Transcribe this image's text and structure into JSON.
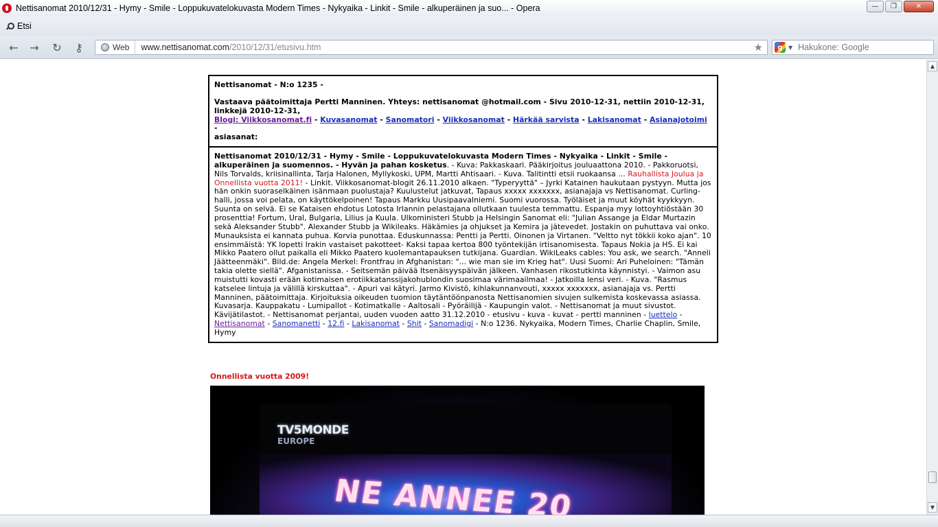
{
  "window": {
    "title": "Nettisanomat 2010/12/31 - Hymy - Smile - Loppukuvatelokuvasta Modern Times - Nykyaika - Linkit - Smile - alkuperäinen ja suo... - Opera",
    "buttons": {
      "minimize": "—",
      "maximize": "❐",
      "close": "✕"
    }
  },
  "tabbar": {
    "search_label": "Etsi"
  },
  "addressbar": {
    "back_icon": "back-arrow-icon",
    "web_label": "Web",
    "url_host": "www.nettisanomat.com",
    "url_path": "/2010/12/31/etusivu.htm",
    "search_placeholder": "Hakukone: Google",
    "search_engine_icon": "g"
  },
  "page": {
    "header": {
      "number": "Nettisanomat - N:o 1235 -",
      "editor": "Vastaava päätoimittaja Pertti Manninen. Yhteys: nettisanomat @hotmail.com - Sivu 2010-12-31, nettiin 2010-12-31, linkkejä 2010-12-31,",
      "links": [
        "Blogi: Viikkosanomat.fi",
        "Kuvasanomat",
        "Sanomatori",
        "Viikkosanomat",
        "Härkää sarvista",
        "Lakisanomat",
        "Asianajotoimi"
      ],
      "sep": " - ",
      "tail": " -",
      "keywords_label": "asiasanat:"
    },
    "article": {
      "lead_bold": "Nettisanomat 2010/12/31 - Hymy - Smile - Loppukuvatelokuvasta Modern Times - Nykyaika - Linkit - Smile - alkuperäinen ja suomennos. - Hyvän ja pahan kosketus",
      "text_1": ". - Kuva: Pakkaskaari. Pääkirjoitus jouluaattona 2010. - Pakkoruotsi, Nils Torvalds, kriisinallinta, Tarja Halonen, Myllykoski, UPM, Martti Ahtisaari. - Kuva. Talitintti etsii ruokaansa ... ",
      "text_red": "Rauhallista Joulua ja Onnellista vuotta 2011!",
      "text_2": " - Linkit. Viikkosanomat-blogit 26.11.2010 alkaen. \"Typeryyttä\" – Jyrki Katainen haukutaan pystyyn. Mutta jos hän onkin suoraselkäinen isänmaan puolustaja? Kuulustelut jatkuvat, Tapaus xxxxx xxxxxxx, asianajaja vs Nettisanomat. Curling-halli, jossa voi pelata, on käyttökelpoinen! Tapaus Markku Uusipaavalniemi. Suomi vuorossa. Työläiset ja muut köyhät kyykkyyn. Suunta on selvä. Ei se Kataisen ehdotus Lotosta Irlannin pelastajana ollutkaan tuulesta temmattu. Espanja myy lottoyhtiöstään 30 prosenttia! Fortum, Ural, Bulgaria, Lilius ja Kuula. Ulkoministeri Stubb ja Helsingin Sanomat eli: \"Julian Assange ja Eldar Murtazin sekä Aleksander Stubb\". Alexander Stubb ja Wikileaks. Häkämies ja ohjukset ja Kemira ja jätevedet. Jostakin on puhuttava vai onko. Munauksista ei kannata puhua. Korvia punottaa. Eduskunnassa: Pentti ja Pertti. Oinonen ja Virtanen. \"Veltto nyt tökkii koko ajan\". 10 ensimmäistä: YK lopetti Irakin vastaiset pakotteet- Kaksi tapaa kertoa 800 työntekijän irtisanomisesta. Tapaus Nokia ja HS. Ei kai Mikko Paatero ollut paikalla eli Mikko Paatero kuolemantapauksen tutkijana. Guardian. WikiLeaks cables: You ask, we search. \"Anneli Jäätteenmäki\". Bild.de: Angela Merkel: Frontfrau in Afghanistan: \"... wie man sie im Krieg hat\". Uusi Suomi: Ari Puheloinen: \"Tämän takia olette siellä\". Afganistanissa. - Seitsemän päivää Itsenäisyyspäivän jälkeen. Vanhasen rikostutkinta käynnistyi. - Vaimon asu muistutti kovasti erään kotimaisen erotiikkatanssijakohublondin suosimaa värimaailmaa! - Jatkoilla lensi veri. - Kuva. \"Rasmus katselee lintuja ja välillä kirskuttaa\". - Apuri vai kätyri. Jarmo Kivistö, kihlakunnanvouti, xxxxx xxxxxxx, asianajaja vs. Pertti Manninen, päätoimittaja. Kirjoituksia oikeuden tuomion täytäntöönpanosta Nettisanomien sivujen sulkemista koskevassa asiassa. Kuvasarja. Kauppakatu - Lumipallot - Kotimatkalle - Aaltosali - Pyöräilijä - Kaupungin valot. - Nettisanomat ja muut sivustot. Kävijätilastot. - Nettisanomat perjantai, uuden vuoden aatto 31.12.2010 - etusivu - kuva - kuvat - pertti manninen - ",
      "link_luettelo": "luettelo",
      "sep": " - ",
      "link_nettisanomat": "Nettisanomat",
      "link_sanomanetti": "Sanomanetti",
      "link_12fi": "12.fi",
      "link_lakisanomat": "Lakisanomat",
      "link_shit": "Shit",
      "link_sanomadigi": "Sanomadigi",
      "text_end": " - N:o 1236. Nykyaika, Modern Times, Charlie Chaplin, Smile, Hymy"
    },
    "greeting": "Onnellista vuotta 2009!",
    "photo": {
      "logo": "TV5MONDE",
      "logo_sub": "EUROPE",
      "stage_text": "NE ANNEE 20"
    }
  },
  "colors": {
    "link": "#1a2bb8",
    "visited_link": "#6a1b9a",
    "red_text": "#d4161b",
    "opera_red": "#d0121b"
  }
}
